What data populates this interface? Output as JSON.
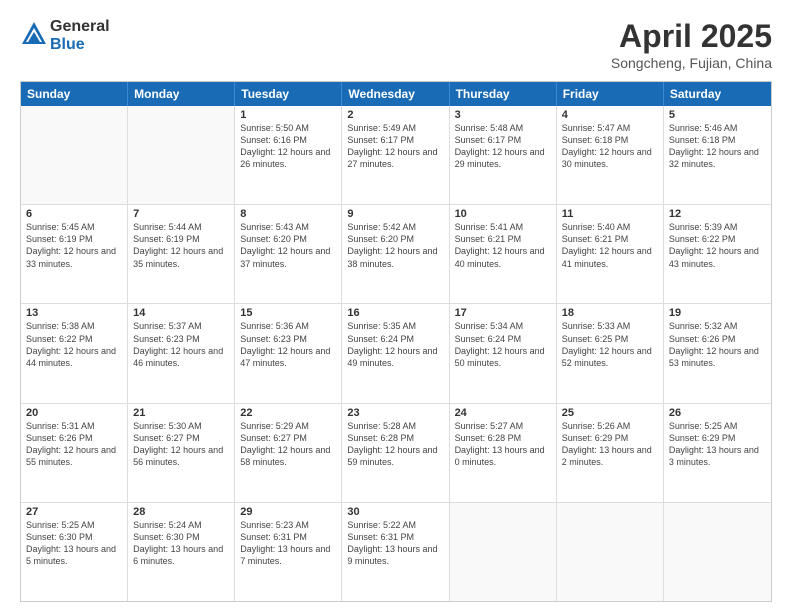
{
  "logo": {
    "general": "General",
    "blue": "Blue"
  },
  "title": {
    "month": "April 2025",
    "location": "Songcheng, Fujian, China"
  },
  "header_days": [
    "Sunday",
    "Monday",
    "Tuesday",
    "Wednesday",
    "Thursday",
    "Friday",
    "Saturday"
  ],
  "weeks": [
    [
      {
        "day": "",
        "text": ""
      },
      {
        "day": "",
        "text": ""
      },
      {
        "day": "1",
        "text": "Sunrise: 5:50 AM\nSunset: 6:16 PM\nDaylight: 12 hours and 26 minutes."
      },
      {
        "day": "2",
        "text": "Sunrise: 5:49 AM\nSunset: 6:17 PM\nDaylight: 12 hours and 27 minutes."
      },
      {
        "day": "3",
        "text": "Sunrise: 5:48 AM\nSunset: 6:17 PM\nDaylight: 12 hours and 29 minutes."
      },
      {
        "day": "4",
        "text": "Sunrise: 5:47 AM\nSunset: 6:18 PM\nDaylight: 12 hours and 30 minutes."
      },
      {
        "day": "5",
        "text": "Sunrise: 5:46 AM\nSunset: 6:18 PM\nDaylight: 12 hours and 32 minutes."
      }
    ],
    [
      {
        "day": "6",
        "text": "Sunrise: 5:45 AM\nSunset: 6:19 PM\nDaylight: 12 hours and 33 minutes."
      },
      {
        "day": "7",
        "text": "Sunrise: 5:44 AM\nSunset: 6:19 PM\nDaylight: 12 hours and 35 minutes."
      },
      {
        "day": "8",
        "text": "Sunrise: 5:43 AM\nSunset: 6:20 PM\nDaylight: 12 hours and 37 minutes."
      },
      {
        "day": "9",
        "text": "Sunrise: 5:42 AM\nSunset: 6:20 PM\nDaylight: 12 hours and 38 minutes."
      },
      {
        "day": "10",
        "text": "Sunrise: 5:41 AM\nSunset: 6:21 PM\nDaylight: 12 hours and 40 minutes."
      },
      {
        "day": "11",
        "text": "Sunrise: 5:40 AM\nSunset: 6:21 PM\nDaylight: 12 hours and 41 minutes."
      },
      {
        "day": "12",
        "text": "Sunrise: 5:39 AM\nSunset: 6:22 PM\nDaylight: 12 hours and 43 minutes."
      }
    ],
    [
      {
        "day": "13",
        "text": "Sunrise: 5:38 AM\nSunset: 6:22 PM\nDaylight: 12 hours and 44 minutes."
      },
      {
        "day": "14",
        "text": "Sunrise: 5:37 AM\nSunset: 6:23 PM\nDaylight: 12 hours and 46 minutes."
      },
      {
        "day": "15",
        "text": "Sunrise: 5:36 AM\nSunset: 6:23 PM\nDaylight: 12 hours and 47 minutes."
      },
      {
        "day": "16",
        "text": "Sunrise: 5:35 AM\nSunset: 6:24 PM\nDaylight: 12 hours and 49 minutes."
      },
      {
        "day": "17",
        "text": "Sunrise: 5:34 AM\nSunset: 6:24 PM\nDaylight: 12 hours and 50 minutes."
      },
      {
        "day": "18",
        "text": "Sunrise: 5:33 AM\nSunset: 6:25 PM\nDaylight: 12 hours and 52 minutes."
      },
      {
        "day": "19",
        "text": "Sunrise: 5:32 AM\nSunset: 6:26 PM\nDaylight: 12 hours and 53 minutes."
      }
    ],
    [
      {
        "day": "20",
        "text": "Sunrise: 5:31 AM\nSunset: 6:26 PM\nDaylight: 12 hours and 55 minutes."
      },
      {
        "day": "21",
        "text": "Sunrise: 5:30 AM\nSunset: 6:27 PM\nDaylight: 12 hours and 56 minutes."
      },
      {
        "day": "22",
        "text": "Sunrise: 5:29 AM\nSunset: 6:27 PM\nDaylight: 12 hours and 58 minutes."
      },
      {
        "day": "23",
        "text": "Sunrise: 5:28 AM\nSunset: 6:28 PM\nDaylight: 12 hours and 59 minutes."
      },
      {
        "day": "24",
        "text": "Sunrise: 5:27 AM\nSunset: 6:28 PM\nDaylight: 13 hours and 0 minutes."
      },
      {
        "day": "25",
        "text": "Sunrise: 5:26 AM\nSunset: 6:29 PM\nDaylight: 13 hours and 2 minutes."
      },
      {
        "day": "26",
        "text": "Sunrise: 5:25 AM\nSunset: 6:29 PM\nDaylight: 13 hours and 3 minutes."
      }
    ],
    [
      {
        "day": "27",
        "text": "Sunrise: 5:25 AM\nSunset: 6:30 PM\nDaylight: 13 hours and 5 minutes."
      },
      {
        "day": "28",
        "text": "Sunrise: 5:24 AM\nSunset: 6:30 PM\nDaylight: 13 hours and 6 minutes."
      },
      {
        "day": "29",
        "text": "Sunrise: 5:23 AM\nSunset: 6:31 PM\nDaylight: 13 hours and 7 minutes."
      },
      {
        "day": "30",
        "text": "Sunrise: 5:22 AM\nSunset: 6:31 PM\nDaylight: 13 hours and 9 minutes."
      },
      {
        "day": "",
        "text": ""
      },
      {
        "day": "",
        "text": ""
      },
      {
        "day": "",
        "text": ""
      }
    ]
  ]
}
